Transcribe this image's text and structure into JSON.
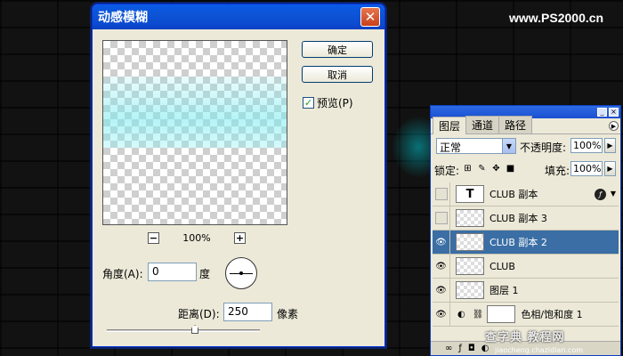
{
  "watermark": "www.PS2000.cn",
  "dialog": {
    "title": "动感模糊",
    "close_glyph": "✕",
    "ok_label": "确定",
    "cancel_label": "取消",
    "preview_label": "预览(P)",
    "preview_checked": true,
    "zoom_out": "−",
    "zoom_in": "+",
    "zoom_value": "100%",
    "angle_label": "角度(A):",
    "angle_value": "0",
    "angle_unit": "度",
    "distance_label": "距离(D):",
    "distance_value": "250",
    "distance_unit": "像素"
  },
  "layers_panel": {
    "tabs": [
      {
        "label": "图层",
        "active": true
      },
      {
        "label": "通道",
        "active": false
      },
      {
        "label": "路径",
        "active": false
      }
    ],
    "blend_mode": "正常",
    "opacity_label": "不透明度:",
    "opacity_value": "100%",
    "lock_label": "锁定:",
    "fill_label": "填充:",
    "fill_value": "100%",
    "layers": [
      {
        "name": "CLUB 副本",
        "visible": false,
        "thumb": "T",
        "type": "text",
        "selected": false
      },
      {
        "name": "CLUB 副本 3",
        "visible": false,
        "type": "pixel",
        "selected": false
      },
      {
        "name": "CLUB 副本 2",
        "visible": true,
        "type": "pixel",
        "selected": true
      },
      {
        "name": "CLUB",
        "visible": true,
        "type": "pixel",
        "selected": false
      },
      {
        "name": "图层 1",
        "visible": true,
        "type": "pixel",
        "selected": false
      },
      {
        "name": "色相/饱和度 1",
        "visible": true,
        "type": "adjustment",
        "selected": false
      }
    ]
  },
  "site_mark": "查字典 教程网",
  "site_url": "jiaocheng.chazidian.com"
}
